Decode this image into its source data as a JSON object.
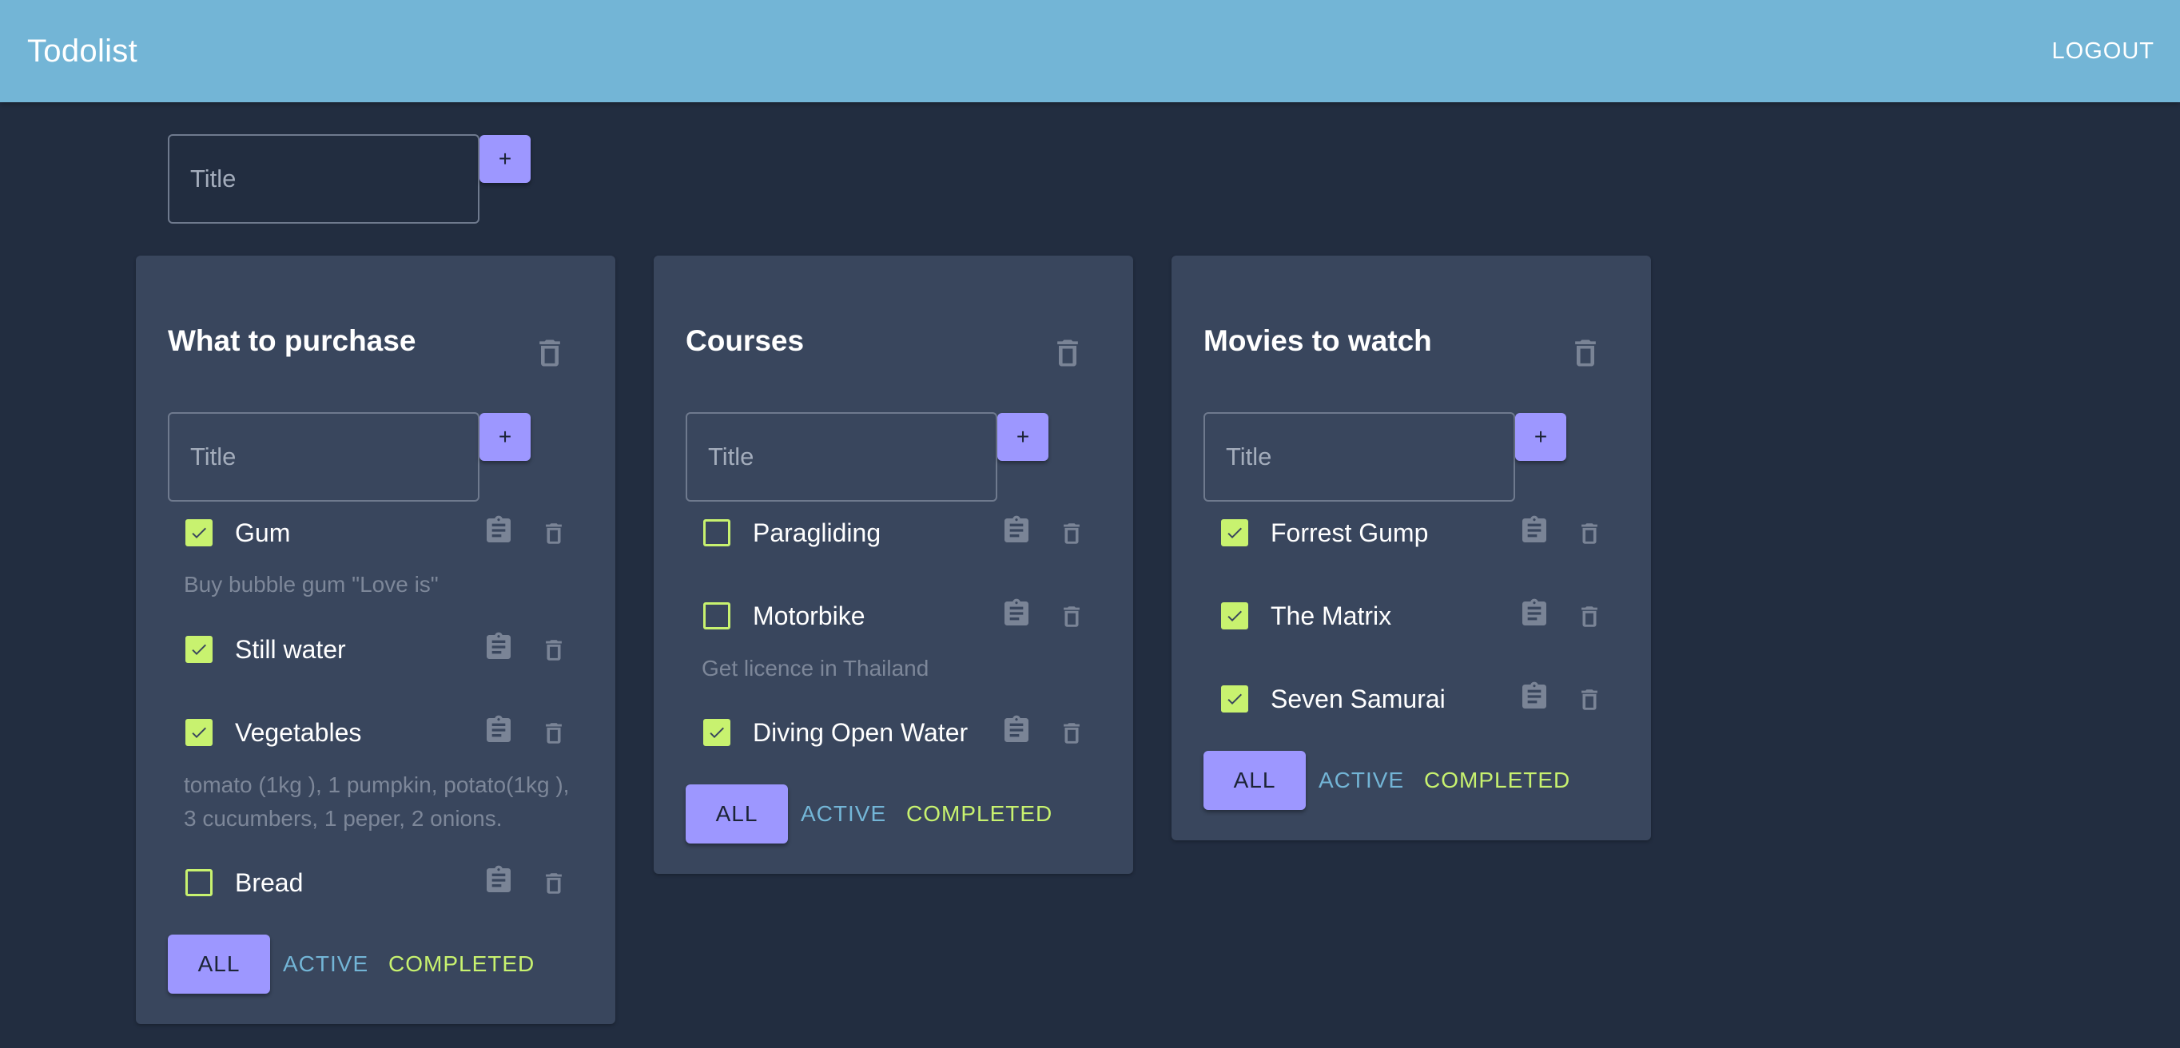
{
  "header": {
    "title": "Todolist",
    "logout_label": "LOGOUT"
  },
  "new_list": {
    "placeholder": "Title",
    "add_label": "+"
  },
  "lists": [
    {
      "title": "What to purchase",
      "input_placeholder": "Title",
      "add_label": "+",
      "tasks": [
        {
          "label": "Gum",
          "checked": true,
          "description": "Buy bubble gum \"Love is\""
        },
        {
          "label": "Still water",
          "checked": true,
          "description": ""
        },
        {
          "label": "Vegetables",
          "checked": true,
          "description_lines": [
            "tomato (1kg ), 1 pumpkin, potato(1kg ),",
            "3 cucumbers, 1 peper, 2 onions."
          ]
        },
        {
          "label": "Bread",
          "checked": false,
          "description": ""
        }
      ],
      "filters": {
        "all": "ALL",
        "active": "ACTIVE",
        "completed": "COMPLETED"
      }
    },
    {
      "title": "Courses",
      "input_placeholder": "Title",
      "add_label": "+",
      "tasks": [
        {
          "label": "Paragliding",
          "checked": false,
          "description": ""
        },
        {
          "label": "Motorbike",
          "checked": false,
          "description": "Get licence in Thailand"
        },
        {
          "label": "Diving Open Water",
          "checked": true,
          "description": ""
        }
      ],
      "filters": {
        "all": "ALL",
        "active": "ACTIVE",
        "completed": "COMPLETED"
      }
    },
    {
      "title": "Movies to watch",
      "input_placeholder": "Title",
      "add_label": "+",
      "tasks": [
        {
          "label": "Forrest Gump",
          "checked": true,
          "description": ""
        },
        {
          "label": "The Matrix",
          "checked": true,
          "description": ""
        },
        {
          "label": "Seven Samurai",
          "checked": true,
          "description": ""
        }
      ],
      "filters": {
        "all": "ALL",
        "active": "ACTIVE",
        "completed": "COMPLETED"
      }
    }
  ],
  "icons": {
    "card_delete": "trash-icon",
    "task_note": "clipboard-icon",
    "task_delete": "trash-icon",
    "checked": "checkmark-icon"
  },
  "colors": {
    "appbar": "#73b5d6",
    "background": "#222d40",
    "card": "#39465d",
    "primary_button": "#9d97ff",
    "checkbox": "#c8f26f",
    "active_filter": "#73b5d6",
    "completed_filter": "#c8f26f",
    "muted_text": "#7d8799"
  }
}
